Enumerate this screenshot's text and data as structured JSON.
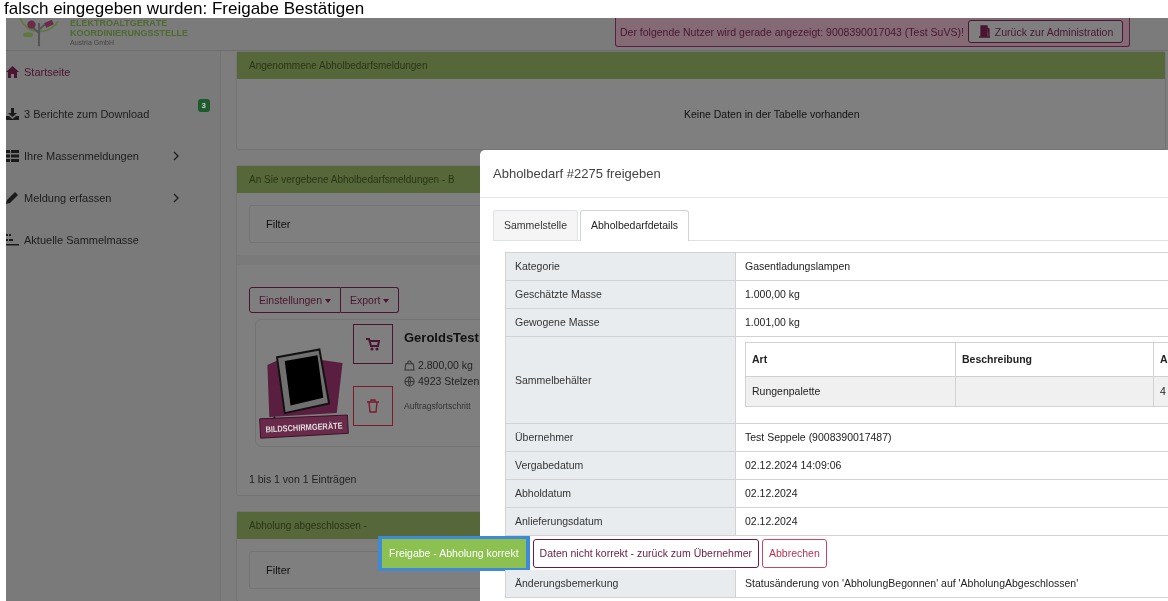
{
  "caption": "falsch eingegeben wurden: Freigabe Bestätigen",
  "logo": {
    "line_1": "ELEKTROALTGERÄTE",
    "line_2": "KOORDINIERUNGSSTELLE",
    "line_3": "Austria GmbH"
  },
  "impersonation_alert": {
    "text": "Der folgende Nutzer wird gerade angezeigt: 9008390017043 (Test SuVS)!",
    "button": "Zurück zur Administration"
  },
  "sidebar": {
    "items": [
      {
        "label": "Startseite",
        "selected": true,
        "has_submenu": false
      },
      {
        "label": "3 Berichte zum Download",
        "selected": false,
        "has_submenu": false,
        "badge": "3"
      },
      {
        "label": "Ihre Massenmeldungen",
        "selected": false,
        "has_submenu": true
      },
      {
        "label": "Meldung erfassen",
        "selected": false,
        "has_submenu": true
      },
      {
        "label": "Aktuelle Sammelmasse",
        "selected": false,
        "has_submenu": false
      }
    ]
  },
  "cards": [
    {
      "title": "Angenommene Abholbedarfsmeldungen",
      "empty_text": "Keine Daten in der Tabelle vorhanden"
    },
    {
      "title": "An Sie vergebene Abholbedarfsmeldungen - B",
      "filter": "Filter",
      "toolbar": [
        "Einstellungen",
        "Export"
      ],
      "item": {
        "image_label": "BILDSCHIRMGERÄTE",
        "name": "GeroldsTest",
        "mass": "2.800,00 kg",
        "location": "4923 Stelzen",
        "progress_label": "Auftragsfortschritt"
      },
      "info": "1 bis 1 von 1 Einträgen"
    },
    {
      "title": "Abholung abgeschlossen -",
      "filter": "Filter"
    }
  ],
  "modal": {
    "title": "Abholbedarf #2275 freigeben",
    "tabs": [
      {
        "label": "Sammelstelle",
        "selected": false
      },
      {
        "label": "Abholbedarfdetails",
        "selected": true
      }
    ],
    "rows": [
      {
        "kind": "text",
        "label": "Kategorie",
        "value": "Gasentladungslampen"
      },
      {
        "kind": "text",
        "label": "Geschätzte Masse",
        "value": "1.000,00 kg"
      },
      {
        "kind": "text",
        "label": "Gewogene Masse",
        "value": "1.001,00 kg"
      },
      {
        "kind": "table",
        "label": "Sammelbehälter",
        "columns": [
          "Art",
          "Beschreibung",
          "A"
        ],
        "cells": [
          [
            "Rungenpalette",
            null,
            "4"
          ]
        ]
      },
      {
        "kind": "text",
        "label": "Übernehmer",
        "value": "Test Seppele (9008390017487)"
      },
      {
        "kind": "text",
        "label": "Vergabedatum",
        "value": "02.12.2024 14:09:06"
      },
      {
        "kind": "text",
        "label": "Abholdatum",
        "value": "02.12.2024"
      },
      {
        "kind": "text",
        "label": "Anlieferungsdatum",
        "value": "02.12.2024"
      },
      {
        "kind": "actions"
      },
      {
        "kind": "text",
        "label": "Änderungsbemerkung",
        "value": "Statusänderung von 'AbholungBegonnen' auf 'AbholungAbgeschlossen'"
      }
    ],
    "buttons": [
      {
        "label": "Freigabe - Abholung korrekt",
        "kind": "confirm",
        "highlighted": true
      },
      {
        "label": "Daten nicht korrekt - zurück zum Übernehmer",
        "kind": "reject",
        "highlighted": false
      },
      {
        "label": "Abbrechen",
        "kind": "cancel",
        "highlighted": false
      }
    ]
  }
}
